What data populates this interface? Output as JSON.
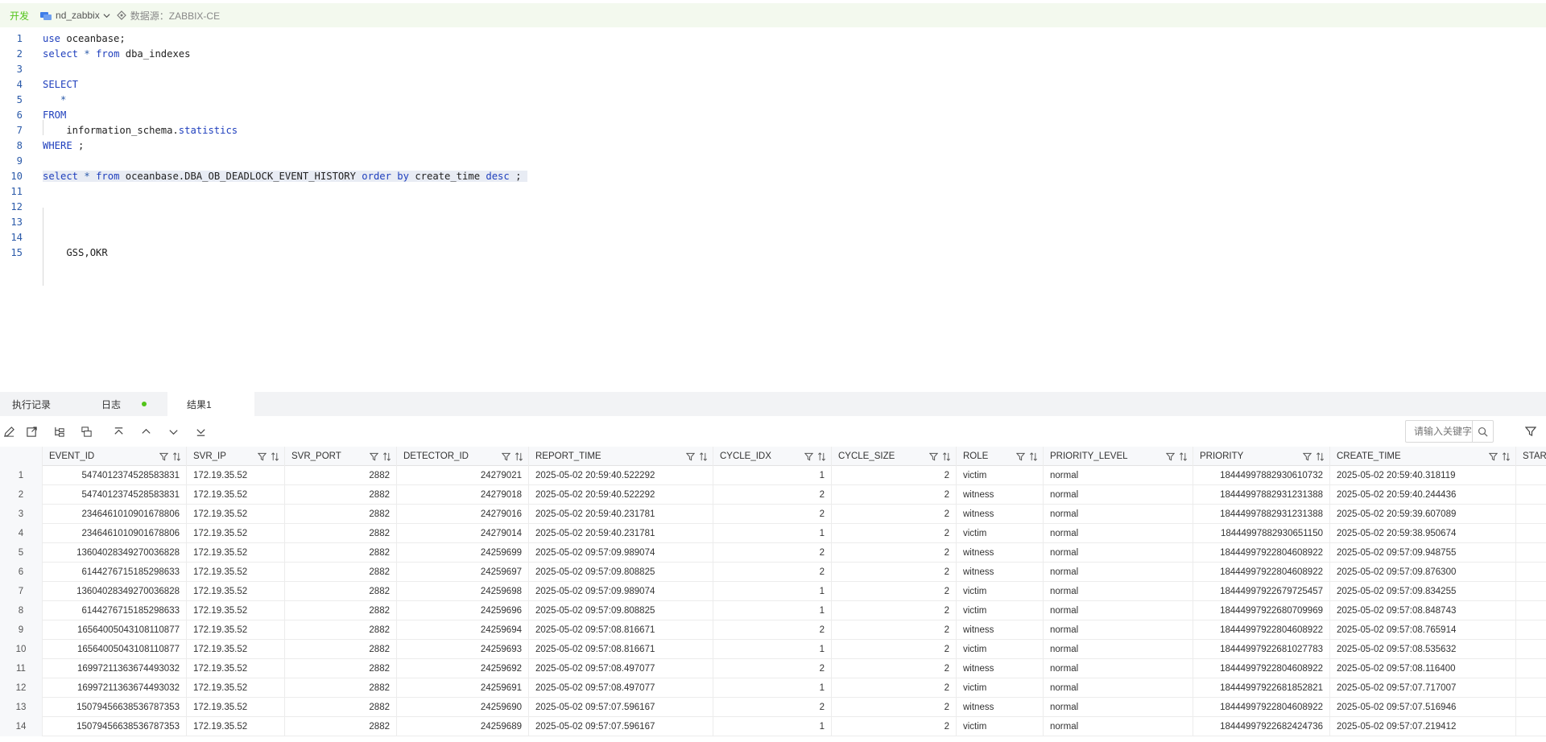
{
  "context": {
    "env": "开发",
    "database": "nd_zabbix",
    "datasource": "数据源：ZABBIX-CE"
  },
  "editor": {
    "line_numbers": [
      "1",
      "2",
      "3",
      "4",
      "5",
      "6",
      "7",
      "8",
      "9",
      "10",
      "11",
      "12",
      "13",
      "14",
      "15"
    ]
  },
  "tabs": {
    "history": "执行记录",
    "log": "日志",
    "result": "结果1"
  },
  "toolbar": {
    "search_placeholder": "请输入关键字"
  },
  "grid": {
    "columns": [
      "EVENT_ID",
      "SVR_IP",
      "SVR_PORT",
      "DETECTOR_ID",
      "REPORT_TIME",
      "CYCLE_IDX",
      "CYCLE_SIZE",
      "ROLE",
      "PRIORITY_LEVEL",
      "PRIORITY",
      "CREATE_TIME",
      "START_"
    ],
    "rows": [
      [
        "1",
        "5474012374528583831",
        "172.19.35.52",
        "2882",
        "24279021",
        "2025-05-02 20:59:40.522292",
        "1",
        "2",
        "victim",
        "normal",
        "18444997882930610732",
        "2025-05-02 20:59:40.318119"
      ],
      [
        "2",
        "5474012374528583831",
        "172.19.35.52",
        "2882",
        "24279018",
        "2025-05-02 20:59:40.522292",
        "2",
        "2",
        "witness",
        "normal",
        "18444997882931231388",
        "2025-05-02 20:59:40.244436"
      ],
      [
        "3",
        "2346461010901678806",
        "172.19.35.52",
        "2882",
        "24279016",
        "2025-05-02 20:59:40.231781",
        "2",
        "2",
        "witness",
        "normal",
        "18444997882931231388",
        "2025-05-02 20:59:39.607089"
      ],
      [
        "4",
        "2346461010901678806",
        "172.19.35.52",
        "2882",
        "24279014",
        "2025-05-02 20:59:40.231781",
        "1",
        "2",
        "victim",
        "normal",
        "18444997882930651150",
        "2025-05-02 20:59:38.950674"
      ],
      [
        "5",
        "13604028349270036828",
        "172.19.35.52",
        "2882",
        "24259699",
        "2025-05-02 09:57:09.989074",
        "2",
        "2",
        "witness",
        "normal",
        "18444997922804608922",
        "2025-05-02 09:57:09.948755"
      ],
      [
        "6",
        "6144276715185298633",
        "172.19.35.52",
        "2882",
        "24259697",
        "2025-05-02 09:57:09.808825",
        "2",
        "2",
        "witness",
        "normal",
        "18444997922804608922",
        "2025-05-02 09:57:09.876300"
      ],
      [
        "7",
        "13604028349270036828",
        "172.19.35.52",
        "2882",
        "24259698",
        "2025-05-02 09:57:09.989074",
        "1",
        "2",
        "victim",
        "normal",
        "18444997922679725457",
        "2025-05-02 09:57:09.834255"
      ],
      [
        "8",
        "6144276715185298633",
        "172.19.35.52",
        "2882",
        "24259696",
        "2025-05-02 09:57:09.808825",
        "1",
        "2",
        "victim",
        "normal",
        "18444997922680709969",
        "2025-05-02 09:57:08.848743"
      ],
      [
        "9",
        "16564005043108110877",
        "172.19.35.52",
        "2882",
        "24259694",
        "2025-05-02 09:57:08.816671",
        "2",
        "2",
        "witness",
        "normal",
        "18444997922804608922",
        "2025-05-02 09:57:08.765914"
      ],
      [
        "10",
        "16564005043108110877",
        "172.19.35.52",
        "2882",
        "24259693",
        "2025-05-02 09:57:08.816671",
        "1",
        "2",
        "victim",
        "normal",
        "18444997922681027783",
        "2025-05-02 09:57:08.535632"
      ],
      [
        "11",
        "16997211363674493032",
        "172.19.35.52",
        "2882",
        "24259692",
        "2025-05-02 09:57:08.497077",
        "2",
        "2",
        "witness",
        "normal",
        "18444997922804608922",
        "2025-05-02 09:57:08.116400"
      ],
      [
        "12",
        "16997211363674493032",
        "172.19.35.52",
        "2882",
        "24259691",
        "2025-05-02 09:57:08.497077",
        "1",
        "2",
        "victim",
        "normal",
        "18444997922681852821",
        "2025-05-02 09:57:07.717007"
      ],
      [
        "13",
        "15079456638536787353",
        "172.19.35.52",
        "2882",
        "24259690",
        "2025-05-02 09:57:07.596167",
        "2",
        "2",
        "witness",
        "normal",
        "18444997922804608922",
        "2025-05-02 09:57:07.516946"
      ],
      [
        "14",
        "15079456638536787353",
        "172.19.35.52",
        "2882",
        "24259689",
        "2025-05-02 09:57:07.596167",
        "1",
        "2",
        "victim",
        "normal",
        "18444997922682424736",
        "2025-05-02 09:57:07.219412"
      ]
    ]
  }
}
